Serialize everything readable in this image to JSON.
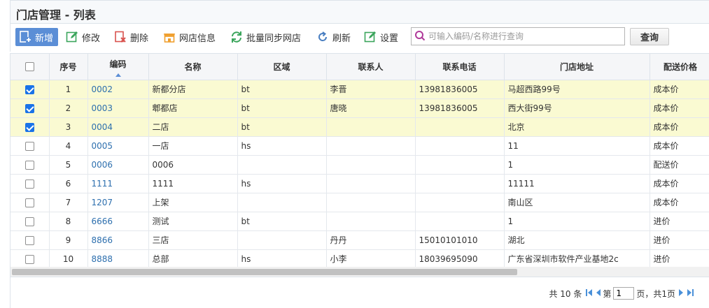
{
  "title": "门店管理 - 列表",
  "toolbar": {
    "add": "新增",
    "edit": "修改",
    "delete": "删除",
    "store_info": "网店信息",
    "batch_sync": "批量同步网店",
    "refresh": "刷新",
    "settings": "设置"
  },
  "search": {
    "placeholder": "可输入编码/名称进行查询",
    "value": "",
    "button": "查询"
  },
  "columns": [
    "序号",
    "编码",
    "名称",
    "区域",
    "联系人",
    "联系电话",
    "门店地址",
    "配送价格"
  ],
  "rows": [
    {
      "checked": true,
      "idx": "1",
      "code": "0002",
      "name": "新都分店",
      "region": "bt",
      "contact": "李晋",
      "phone": "13981836005",
      "address": "马超西路99号",
      "price": "成本价"
    },
    {
      "checked": true,
      "idx": "2",
      "code": "0003",
      "name": "郫都店",
      "region": "bt",
      "contact": "唐晓",
      "phone": "13981836005",
      "address": "西大街99号",
      "price": "成本价"
    },
    {
      "checked": true,
      "idx": "3",
      "code": "0004",
      "name": "二店",
      "region": "bt",
      "contact": "",
      "phone": "",
      "address": "北京",
      "price": "成本价"
    },
    {
      "checked": false,
      "idx": "4",
      "code": "0005",
      "name": "一店",
      "region": "hs",
      "contact": "",
      "phone": "",
      "address": "11",
      "price": "成本价"
    },
    {
      "checked": false,
      "idx": "5",
      "code": "0006",
      "name": "0006",
      "region": "",
      "contact": "",
      "phone": "",
      "address": "1",
      "price": "配送价"
    },
    {
      "checked": false,
      "idx": "6",
      "code": "1111",
      "name": "1111",
      "region": "hs",
      "contact": "",
      "phone": "",
      "address": "11111",
      "price": "成本价"
    },
    {
      "checked": false,
      "idx": "7",
      "code": "1207",
      "name": "上架",
      "region": "",
      "contact": "",
      "phone": "",
      "address": "南山区",
      "price": "成本价"
    },
    {
      "checked": false,
      "idx": "8",
      "code": "6666",
      "name": "测试",
      "region": "bt",
      "contact": "",
      "phone": "",
      "address": "1",
      "price": "进价"
    },
    {
      "checked": false,
      "idx": "9",
      "code": "8866",
      "name": "三店",
      "region": "",
      "contact": "丹丹",
      "phone": "15010101010",
      "address": "湖北",
      "price": "进价"
    },
    {
      "checked": false,
      "idx": "10",
      "code": "8888",
      "name": "总部",
      "region": "hs",
      "contact": "小李",
      "phone": "18039695090",
      "address": "广东省深圳市软件产业基地2c",
      "price": "进价"
    }
  ],
  "pager": {
    "total": "共 10 条",
    "page_label": "第",
    "page_value": "1",
    "page_suffix": "页，共1页"
  },
  "colors": {
    "accent": "#5b8ed6",
    "selected_row": "#fafad2",
    "code_link": "#2d6fae",
    "checkbox_on": "#1a73e8"
  },
  "icons": [
    "add-icon",
    "edit-icon",
    "delete-icon",
    "store-icon",
    "sync-icon",
    "refresh-icon",
    "settings-icon",
    "search-icon",
    "first-page-icon",
    "prev-page-icon",
    "next-page-icon",
    "last-page-icon"
  ]
}
